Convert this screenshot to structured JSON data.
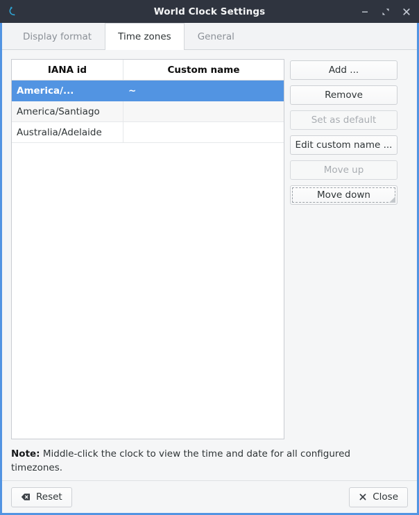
{
  "window": {
    "title": "World Clock Settings",
    "app_icon": "clock-refresh-icon",
    "accent_color": "#5294e2",
    "titlebar_color": "#2f343f",
    "controls": {
      "minimize": "minimize-icon",
      "maximize": "maximize-icon",
      "close": "close-icon"
    }
  },
  "tabs": [
    {
      "label": "Display format",
      "active": false
    },
    {
      "label": "Time zones",
      "active": true
    },
    {
      "label": "General",
      "active": false
    }
  ],
  "table": {
    "columns": [
      "IANA id",
      "Custom name"
    ],
    "rows": [
      {
        "iana_id": "America/...",
        "custom_name": "~",
        "selected": true
      },
      {
        "iana_id": "America/Santiago",
        "custom_name": "",
        "selected": false
      },
      {
        "iana_id": "Australia/Adelaide",
        "custom_name": "",
        "selected": false
      }
    ]
  },
  "side_buttons": [
    {
      "label": "Add ...",
      "enabled": true,
      "focused": false
    },
    {
      "label": "Remove",
      "enabled": true,
      "focused": false
    },
    {
      "label": "Set as default",
      "enabled": false,
      "focused": false
    },
    {
      "label": "Edit custom name ...",
      "enabled": true,
      "focused": false
    },
    {
      "label": "Move up",
      "enabled": false,
      "focused": false
    },
    {
      "label": "Move down",
      "enabled": true,
      "focused": true
    }
  ],
  "note": {
    "label": "Note:",
    "text": " Middle-click the clock to view the time and date for all configured timezones."
  },
  "action_bar": {
    "reset": {
      "label": "Reset",
      "icon": "undo-reset-icon"
    },
    "close": {
      "label": "Close",
      "icon": "close-x-icon"
    }
  }
}
